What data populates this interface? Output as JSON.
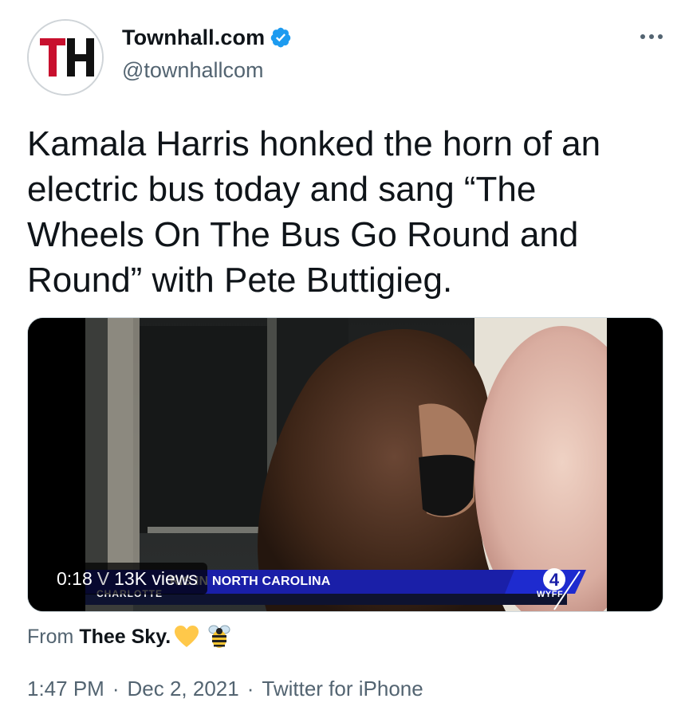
{
  "account": {
    "avatar_text": "TH",
    "display_name": "Townhall.com",
    "handle": "@townhallcom",
    "verified": true
  },
  "tweet": {
    "text": "Kamala Harris honked the horn of an\nelectric bus today and sang “The\nWheels On The Bus Go Round and\nRound” with Pete Buttigieg."
  },
  "video": {
    "duration": "0:18",
    "views": "13K views",
    "lower_third_prefix": "V",
    "lower_third": "RIS IN NORTH CAROLINA",
    "location": "CHARLOTTE",
    "station_number": "4",
    "station_call": "WYFF"
  },
  "source": {
    "prefix": "From",
    "name": "Thee Sky.",
    "emojis": [
      "yellow-heart",
      "bee"
    ]
  },
  "meta": {
    "time": "1:47 PM",
    "date": "Dec 2, 2021",
    "client": "Twitter for iPhone"
  },
  "colors": {
    "text": "#0f1419",
    "secondary": "#536471",
    "verified": "#1d9bf0",
    "avatar_red": "#c8102e",
    "lower_third": "#1a1fa8"
  },
  "icons": {
    "verified": "verified-badge-icon",
    "more": "more-options-icon"
  }
}
